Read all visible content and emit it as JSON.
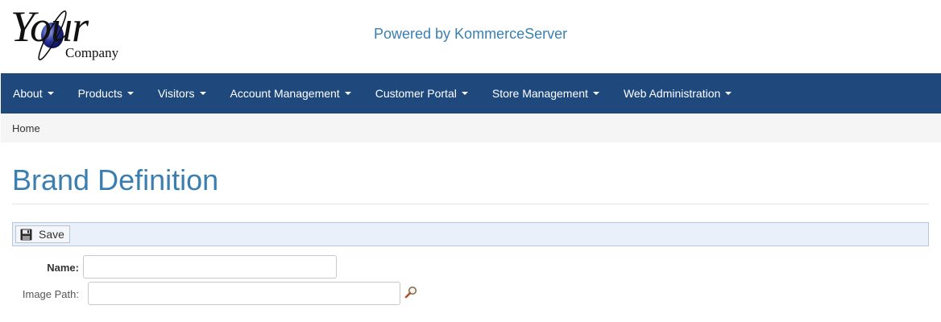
{
  "header": {
    "logo_main": "Your",
    "logo_sub": "Company",
    "powered_by": "Powered by KommerceServer"
  },
  "nav": {
    "items": [
      {
        "label": "About"
      },
      {
        "label": "Products"
      },
      {
        "label": "Visitors"
      },
      {
        "label": "Account Management"
      },
      {
        "label": "Customer Portal"
      },
      {
        "label": "Store Management"
      },
      {
        "label": "Web Administration"
      }
    ]
  },
  "breadcrumb": {
    "home": "Home"
  },
  "page": {
    "title": "Brand Definition"
  },
  "toolbar": {
    "save_label": "Save"
  },
  "form": {
    "name_label": "Name:",
    "name_value": "",
    "image_path_label": "Image Path:",
    "image_path_value": ""
  },
  "colors": {
    "navbar": "#1f497d",
    "accent": "#3a7fb0",
    "breadcrumb_bg": "#f5f5f5",
    "toolbar_bg": "#eaf0fa"
  },
  "icons": {
    "save": "floppy-disk-icon",
    "lookup": "magnifier-icon",
    "dropdown": "caret-down-icon"
  }
}
